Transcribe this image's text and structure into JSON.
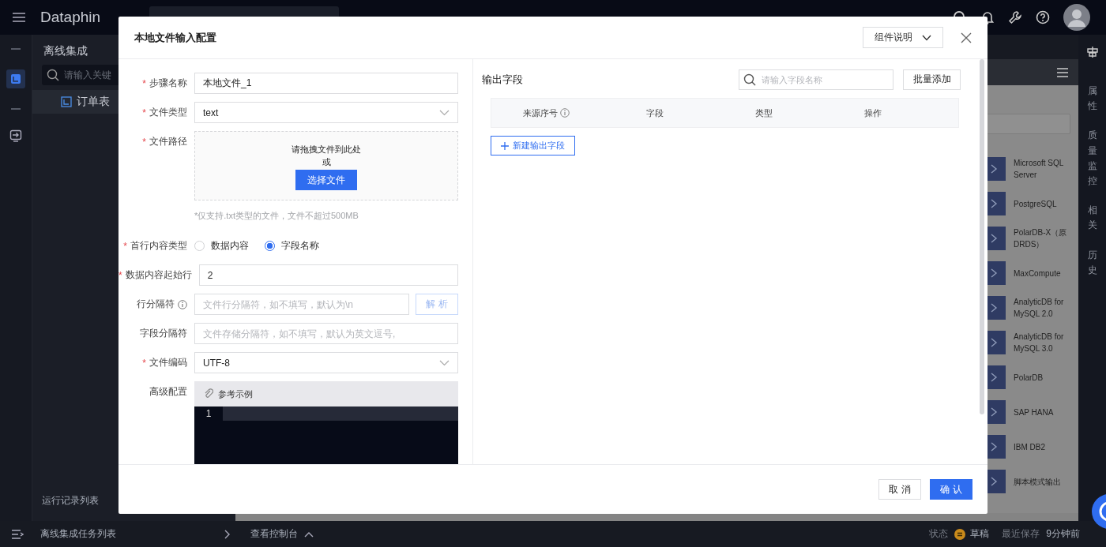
{
  "app": {
    "logo": "Dataphin"
  },
  "sidebar": {
    "title": "离线集成",
    "search_placeholder": "请输入关键",
    "tree_item": "订单表",
    "footer_items": [
      "运行记录列表",
      "离线集成任务列表"
    ]
  },
  "components": [
    {
      "name": "Microsoft SQL Server"
    },
    {
      "name": "PostgreSQL"
    },
    {
      "name": "PolarDB-X（原DRDS）"
    },
    {
      "name": "MaxCompute"
    },
    {
      "name": "AnalyticDB for MySQL 2.0"
    },
    {
      "name": "AnalyticDB for MySQL 3.0"
    },
    {
      "name": "PolarDB"
    },
    {
      "name": "SAP HANA"
    },
    {
      "name": "IBM DB2"
    },
    {
      "name": "脚本模式输出"
    }
  ],
  "right_tabs": [
    "属性",
    "质量监控",
    "相关",
    "历史"
  ],
  "status_bar": {
    "console": "查看控制台",
    "status_label": "状态",
    "status_value": "草稿",
    "saved_label": "最近保存",
    "saved_value": "9分钟前"
  },
  "dialog": {
    "title": "本地文件输入配置",
    "doc_button": "组件说明",
    "fields": [
      {
        "kind": "input",
        "label": "步骤名称",
        "marker": "*",
        "value": "本地文件_1"
      },
      {
        "kind": "select",
        "label": "文件类型",
        "marker": "*",
        "value": "text"
      },
      {
        "kind": "upload",
        "label": "文件路径",
        "marker": "*",
        "prompt": "请拖拽文件到此处",
        "or": "或",
        "button": "选择文件",
        "hint": "*仅支持.txt类型的文件，文件不超过500MB"
      },
      {
        "kind": "radio",
        "label": "首行内容类型",
        "marker": "*",
        "options": [
          {
            "label": "数据内容",
            "selected": false
          },
          {
            "label": "字段名称",
            "selected": true
          }
        ]
      },
      {
        "kind": "input",
        "label": "数据内容起始行",
        "marker": "*",
        "value": "2"
      },
      {
        "kind": "input",
        "label": "行分隔符",
        "info": true,
        "placeholder": "文件行分隔符，如不填写，默认为\\n",
        "button": "解 析"
      },
      {
        "kind": "input",
        "label": "字段分隔符",
        "placeholder": "文件存储分隔符，如不填写，默认为英文逗号,"
      },
      {
        "kind": "select",
        "label": "文件编码",
        "marker": "*",
        "value": "UTF-8"
      },
      {
        "kind": "code",
        "label": "高级配置",
        "toolbar": "参考示例",
        "line_numbers": [
          "1"
        ]
      }
    ],
    "output": {
      "title": "输出字段",
      "search_placeholder": "请输入字段名称",
      "batch_button": "批量添加",
      "columns": [
        {
          "label": "来源序号",
          "info": true
        },
        {
          "label": "字段"
        },
        {
          "label": "类型"
        },
        {
          "label": "操作"
        }
      ],
      "add_button": "新建输出字段"
    },
    "buttons": [
      {
        "label": "取 消",
        "kind": "secondary"
      },
      {
        "label": "确 认",
        "kind": "primary"
      }
    ]
  }
}
